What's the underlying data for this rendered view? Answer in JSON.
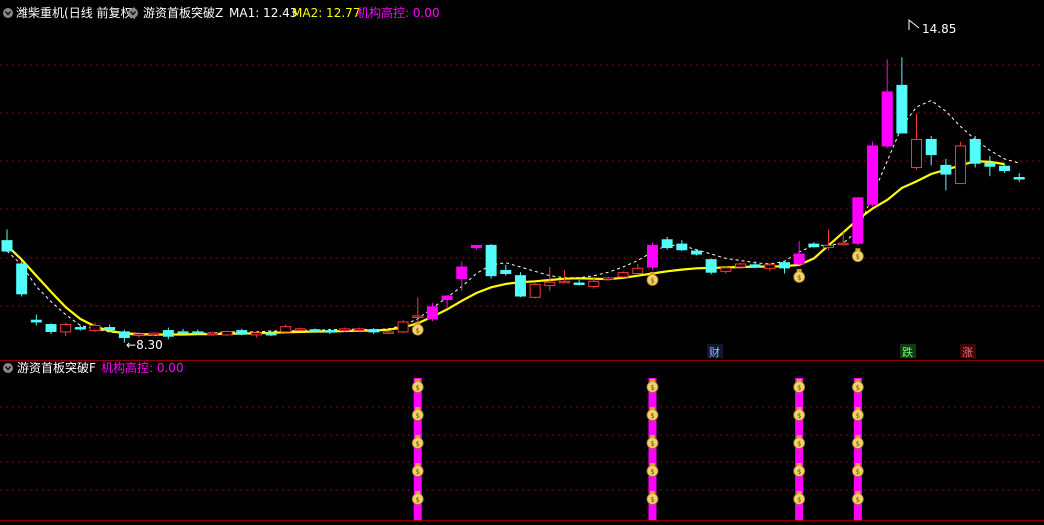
{
  "main_panel": {
    "stock_name": "潍柴重机",
    "period": "(日线 前复权)",
    "indicator": "游资首板突破Z",
    "ma1_label": "MA1: 12.43",
    "ma2_label": "MA2: 12.77",
    "inst_label": "机构高控: 0.00",
    "high_label": "14.85",
    "low_label": "8.30",
    "markers": [
      "财",
      "跌",
      "涨"
    ]
  },
  "sub_panel": {
    "indicator": "游资首板突破F",
    "inst_label": "机构高控: 0.00"
  },
  "colors": {
    "up": "#ff3a3a",
    "down": "#54fcfc",
    "limit_up": "#ff00ff",
    "ma1": "#ffffff",
    "ma2": "#ffff00",
    "grid": "#8b0000",
    "inst": "#ff00ff"
  },
  "chart_data": {
    "type": "candlestick",
    "ylim": [
      7.9,
      15.6
    ],
    "grid": true,
    "candles": [
      {
        "o": 10.66,
        "h": 10.92,
        "l": 10.4,
        "c": 10.42,
        "t": "down"
      },
      {
        "o": 10.12,
        "h": 10.18,
        "l": 9.37,
        "c": 9.43,
        "t": "down"
      },
      {
        "o": 8.82,
        "h": 8.95,
        "l": 8.7,
        "c": 8.78,
        "t": "down"
      },
      {
        "o": 8.72,
        "h": 8.75,
        "l": 8.5,
        "c": 8.56,
        "t": "down"
      },
      {
        "o": 8.55,
        "h": 8.76,
        "l": 8.45,
        "c": 8.72,
        "t": "up"
      },
      {
        "o": 8.65,
        "h": 8.7,
        "l": 8.58,
        "c": 8.62,
        "t": "down"
      },
      {
        "o": 8.58,
        "h": 8.76,
        "l": 8.55,
        "c": 8.7,
        "t": "up"
      },
      {
        "o": 8.65,
        "h": 8.72,
        "l": 8.55,
        "c": 8.6,
        "t": "down"
      },
      {
        "o": 8.55,
        "h": 8.6,
        "l": 8.3,
        "c": 8.42,
        "t": "down"
      },
      {
        "o": 8.48,
        "h": 8.55,
        "l": 8.42,
        "c": 8.5,
        "t": "up"
      },
      {
        "o": 8.52,
        "h": 8.54,
        "l": 8.47,
        "c": 8.5,
        "t": "up"
      },
      {
        "o": 8.58,
        "h": 8.65,
        "l": 8.38,
        "c": 8.45,
        "t": "down"
      },
      {
        "o": 8.55,
        "h": 8.62,
        "l": 8.5,
        "c": 8.53,
        "t": "down"
      },
      {
        "o": 8.55,
        "h": 8.6,
        "l": 8.48,
        "c": 8.53,
        "t": "down"
      },
      {
        "o": 8.5,
        "h": 8.56,
        "l": 8.48,
        "c": 8.52,
        "t": "up"
      },
      {
        "o": 8.48,
        "h": 8.58,
        "l": 8.46,
        "c": 8.56,
        "t": "up"
      },
      {
        "o": 8.58,
        "h": 8.62,
        "l": 8.47,
        "c": 8.5,
        "t": "down"
      },
      {
        "o": 8.48,
        "h": 8.55,
        "l": 8.42,
        "c": 8.53,
        "t": "up"
      },
      {
        "o": 8.52,
        "h": 8.56,
        "l": 8.45,
        "c": 8.48,
        "t": "down"
      },
      {
        "o": 8.55,
        "h": 8.72,
        "l": 8.5,
        "c": 8.67,
        "t": "up"
      },
      {
        "o": 8.6,
        "h": 8.65,
        "l": 8.58,
        "c": 8.62,
        "t": "up"
      },
      {
        "o": 8.6,
        "h": 8.63,
        "l": 8.53,
        "c": 8.57,
        "t": "down"
      },
      {
        "o": 8.58,
        "h": 8.62,
        "l": 8.5,
        "c": 8.55,
        "t": "down"
      },
      {
        "o": 8.58,
        "h": 8.65,
        "l": 8.55,
        "c": 8.62,
        "t": "up"
      },
      {
        "o": 8.62,
        "h": 8.65,
        "l": 8.58,
        "c": 8.6,
        "t": "up"
      },
      {
        "o": 8.6,
        "h": 8.64,
        "l": 8.5,
        "c": 8.55,
        "t": "down"
      },
      {
        "o": 8.52,
        "h": 8.58,
        "l": 8.5,
        "c": 8.55,
        "t": "up"
      },
      {
        "o": 8.55,
        "h": 8.82,
        "l": 8.52,
        "c": 8.78,
        "t": "up"
      },
      {
        "o": 8.9,
        "h": 9.35,
        "l": 8.75,
        "c": 8.92,
        "t": "up"
      },
      {
        "o": 8.85,
        "h": 9.22,
        "l": 8.8,
        "c": 9.13,
        "t": "limit"
      },
      {
        "o": 9.3,
        "h": 9.4,
        "l": 9.1,
        "c": 9.38,
        "t": "limit"
      },
      {
        "o": 9.78,
        "h": 10.18,
        "l": 9.5,
        "c": 10.05,
        "t": "limit"
      },
      {
        "o": 10.55,
        "h": 10.55,
        "l": 10.45,
        "c": 10.5,
        "t": "limit"
      },
      {
        "o": 10.55,
        "h": 10.58,
        "l": 9.78,
        "c": 9.85,
        "t": "down"
      },
      {
        "o": 9.97,
        "h": 10.1,
        "l": 9.85,
        "c": 9.9,
        "t": "down"
      },
      {
        "o": 9.85,
        "h": 9.93,
        "l": 9.35,
        "c": 9.38,
        "t": "down"
      },
      {
        "o": 9.35,
        "h": 9.68,
        "l": 9.32,
        "c": 9.65,
        "t": "up"
      },
      {
        "o": 9.62,
        "h": 10.05,
        "l": 9.5,
        "c": 9.7,
        "t": "up"
      },
      {
        "o": 9.72,
        "h": 9.98,
        "l": 9.7,
        "c": 9.72,
        "t": "up"
      },
      {
        "o": 9.68,
        "h": 9.75,
        "l": 9.62,
        "c": 9.65,
        "t": "down"
      },
      {
        "o": 9.6,
        "h": 9.8,
        "l": 9.55,
        "c": 9.72,
        "t": "up"
      },
      {
        "o": 9.78,
        "h": 9.82,
        "l": 9.75,
        "c": 9.8,
        "t": "up"
      },
      {
        "o": 9.82,
        "h": 9.95,
        "l": 9.8,
        "c": 9.92,
        "t": "up"
      },
      {
        "o": 9.9,
        "h": 10.12,
        "l": 9.85,
        "c": 10.02,
        "t": "up"
      },
      {
        "o": 10.05,
        "h": 10.62,
        "l": 9.98,
        "c": 10.55,
        "t": "limit"
      },
      {
        "o": 10.68,
        "h": 10.75,
        "l": 10.45,
        "c": 10.5,
        "t": "down"
      },
      {
        "o": 10.58,
        "h": 10.67,
        "l": 10.42,
        "c": 10.45,
        "t": "down"
      },
      {
        "o": 10.42,
        "h": 10.46,
        "l": 10.32,
        "c": 10.35,
        "t": "down"
      },
      {
        "o": 10.22,
        "h": 10.25,
        "l": 9.88,
        "c": 9.93,
        "t": "down"
      },
      {
        "o": 9.95,
        "h": 10.08,
        "l": 9.9,
        "c": 10.03,
        "t": "up"
      },
      {
        "o": 10.05,
        "h": 10.15,
        "l": 10.0,
        "c": 10.12,
        "t": "up"
      },
      {
        "o": 10.1,
        "h": 10.18,
        "l": 10.02,
        "c": 10.06,
        "t": "down"
      },
      {
        "o": 10.02,
        "h": 10.15,
        "l": 9.95,
        "c": 10.1,
        "t": "up"
      },
      {
        "o": 10.15,
        "h": 10.2,
        "l": 9.9,
        "c": 10.03,
        "t": "down"
      },
      {
        "o": 10.12,
        "h": 10.65,
        "l": 10.1,
        "c": 10.35,
        "t": "limit"
      },
      {
        "o": 10.58,
        "h": 10.62,
        "l": 10.5,
        "c": 10.52,
        "t": "down"
      },
      {
        "o": 10.5,
        "h": 10.92,
        "l": 10.45,
        "c": 10.55,
        "t": "up"
      },
      {
        "o": 10.6,
        "h": 10.88,
        "l": 10.55,
        "c": 10.6,
        "t": "up"
      },
      {
        "o": 10.6,
        "h": 11.65,
        "l": 10.55,
        "c": 11.65,
        "t": "limit"
      },
      {
        "o": 11.5,
        "h": 12.95,
        "l": 11.45,
        "c": 12.85,
        "t": "limit"
      },
      {
        "o": 12.85,
        "h": 14.85,
        "l": 12.8,
        "c": 14.1,
        "t": "limit"
      },
      {
        "o": 14.25,
        "h": 14.9,
        "l": 13.15,
        "c": 13.15,
        "t": "down"
      },
      {
        "o": 12.35,
        "h": 13.6,
        "l": 12.3,
        "c": 13.0,
        "t": "up"
      },
      {
        "o": 13.0,
        "h": 13.08,
        "l": 12.4,
        "c": 12.65,
        "t": "down"
      },
      {
        "o": 12.4,
        "h": 12.55,
        "l": 11.82,
        "c": 12.2,
        "t": "down"
      },
      {
        "o": 11.98,
        "h": 12.95,
        "l": 11.98,
        "c": 12.85,
        "t": "up"
      },
      {
        "o": 13.0,
        "h": 13.08,
        "l": 12.35,
        "c": 12.45,
        "t": "down"
      },
      {
        "o": 12.45,
        "h": 12.62,
        "l": 12.15,
        "c": 12.38,
        "t": "down"
      },
      {
        "o": 12.38,
        "h": 12.42,
        "l": 12.22,
        "c": 12.28,
        "t": "down"
      },
      {
        "o": 12.12,
        "h": 12.22,
        "l": 12.02,
        "c": 12.1,
        "t": "down"
      }
    ],
    "ma2": [
      10.55,
      10.22,
      9.85,
      9.48,
      9.12,
      8.85,
      8.68,
      8.57,
      8.52,
      8.5,
      8.49,
      8.49,
      8.49,
      8.5,
      8.5,
      8.51,
      8.51,
      8.52,
      8.53,
      8.54,
      8.55,
      8.56,
      8.56,
      8.57,
      8.58,
      8.58,
      8.6,
      8.65,
      8.75,
      8.9,
      9.07,
      9.27,
      9.45,
      9.58,
      9.66,
      9.7,
      9.72,
      9.75,
      9.78,
      9.79,
      9.78,
      9.77,
      9.8,
      9.85,
      9.9,
      9.95,
      9.99,
      10.02,
      10.03,
      10.04,
      10.05,
      10.06,
      10.06,
      10.07,
      10.1,
      10.25,
      10.55,
      10.85,
      11.15,
      11.4,
      11.6,
      11.88,
      12.03,
      12.2,
      12.3,
      12.4,
      12.5,
      12.48,
      12.43
    ],
    "ma1": [
      10.42,
      10.1,
      9.6,
      9.25,
      8.95,
      8.7,
      8.62,
      8.55,
      8.5,
      8.47,
      8.47,
      8.48,
      8.5,
      8.52,
      8.53,
      8.55,
      8.55,
      8.55,
      8.57,
      8.57,
      8.58,
      8.59,
      8.6,
      8.61,
      8.61,
      8.6,
      8.62,
      8.7,
      8.85,
      9.1,
      9.35,
      9.6,
      9.9,
      10.1,
      10.15,
      10.05,
      9.95,
      9.85,
      9.8,
      9.8,
      9.85,
      9.93,
      10.05,
      10.2,
      10.4,
      10.55,
      10.55,
      10.45,
      10.35,
      10.25,
      10.2,
      10.15,
      10.12,
      10.18,
      10.4,
      10.55,
      10.55,
      10.6,
      10.9,
      11.7,
      12.5,
      13.3,
      13.75,
      13.9,
      13.65,
      13.3,
      13.0,
      12.75,
      12.55,
      12.45
    ],
    "money_bags": [
      28,
      44,
      54,
      58
    ],
    "low": {
      "index": 8,
      "value": 8.3,
      "label": "8.30"
    },
    "high": {
      "index": 60,
      "value": 14.85,
      "label": "14.85"
    }
  }
}
